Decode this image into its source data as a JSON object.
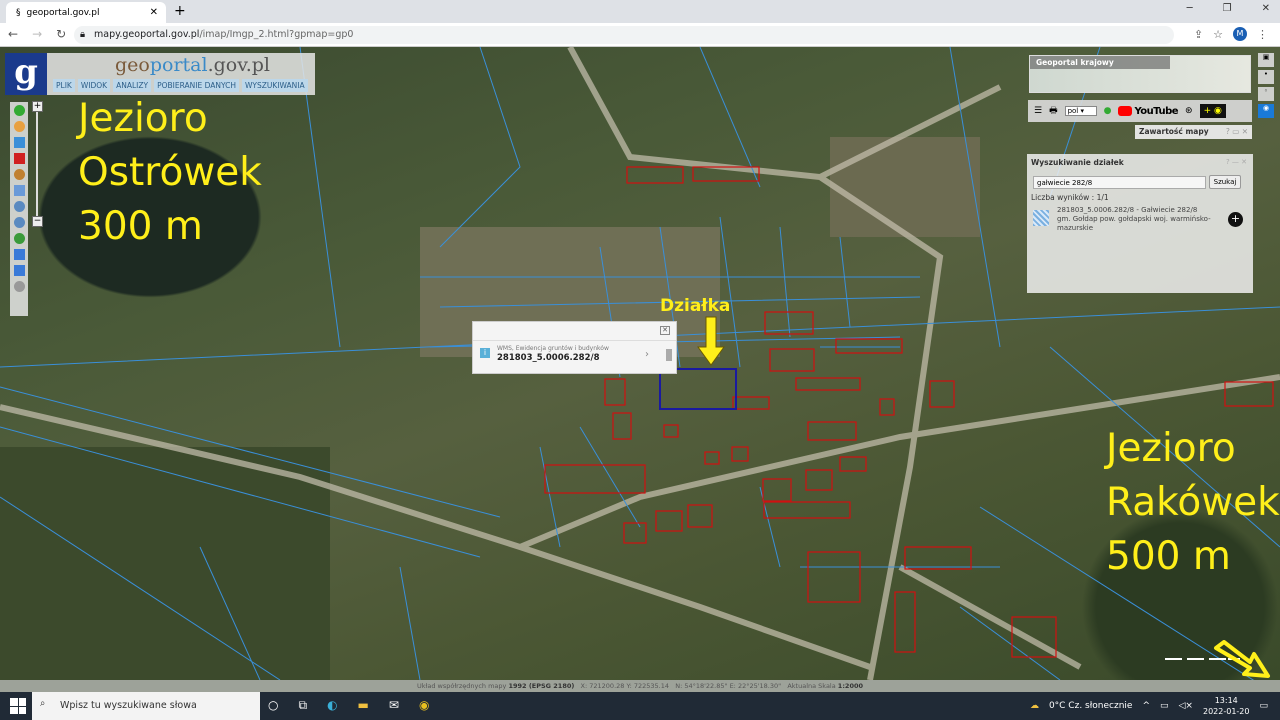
{
  "browser": {
    "tab_title": "geoportal.gov.pl",
    "url_domain": "mapy.geoportal.gov.pl",
    "url_path": "/imap/Imgp_2.html?gpmap=gp0",
    "profile_initial": "M"
  },
  "app": {
    "logo_letter": "g",
    "logo_prefix": "geo",
    "logo_accent": "portal",
    "logo_suffix": ".gov.pl",
    "menu": [
      "PLIK",
      "WIDOK",
      "ANALIZY",
      "POBIERANIE DANYCH",
      "WYSZUKIWANIA"
    ]
  },
  "annotations": {
    "lake1": [
      "Jezioro",
      "Ostrówek",
      "300 m"
    ],
    "lake2": [
      "Jezioro",
      "Rakówek",
      "500 m"
    ],
    "parcel": "Działka",
    "color": "#ffef1a"
  },
  "popup": {
    "layer": "WMS, Ewidencja gruntów i budynków",
    "id": "281803_5.0006.282/8"
  },
  "minimap": {
    "label": "Geoportal krajowy"
  },
  "toolbar": {
    "language": "pol",
    "youtube": "YouTube"
  },
  "map_content": {
    "title": "Zawartość mapy"
  },
  "parcel_search": {
    "title": "Wyszukiwanie działek",
    "query": "gałwiecie 282/8",
    "button": "Szukaj",
    "count": "Liczba wyników : 1/1",
    "result_title": "281803_5.0006.282/8 - Gałwiecie 282/8",
    "result_desc": "gm. Gołdap pow. gołdapski woj. warmińsko-mazurskie"
  },
  "statusbar": {
    "crs_label": "Układ współrzędnych mapy",
    "crs": "1992 (EPSG 2180)",
    "x": "X: 721200.28",
    "y": "Y: 722535.14",
    "n": "N: 54°18'22.85\"",
    "e": "E: 22°25'18.30\"",
    "scale_label": "Aktualna Skala",
    "scale": "1:2000"
  },
  "taskbar": {
    "search_placeholder": "Wpisz tu wyszukiwane słowa",
    "weather": "0°C  Cz. słonecznie",
    "time": "13:14",
    "date": "2022-01-20"
  },
  "colors": {
    "parcel_lines": "#3a8fd8",
    "buildings": "#d01010",
    "selected_parcel": "#1a1aa0"
  }
}
